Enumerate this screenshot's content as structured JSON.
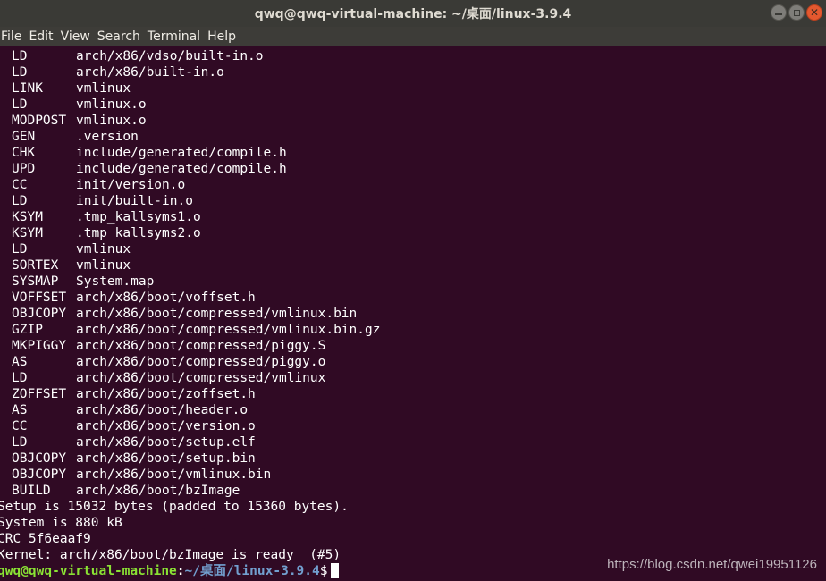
{
  "window": {
    "title": "qwq@qwq-virtual-machine: ~/桌面/linux-3.9.4",
    "buttons": {
      "minimize": "minimize",
      "maximize": "maximize",
      "close": "close"
    }
  },
  "menu": {
    "items": [
      "File",
      "Edit",
      "View",
      "Search",
      "Terminal",
      "Help"
    ]
  },
  "terminal": {
    "build_lines": [
      {
        "cmd": "LD",
        "target": "arch/x86/vdso/built-in.o"
      },
      {
        "cmd": "LD",
        "target": "arch/x86/built-in.o"
      },
      {
        "cmd": "LINK",
        "target": "vmlinux"
      },
      {
        "cmd": "LD",
        "target": "vmlinux.o"
      },
      {
        "cmd": "MODPOST",
        "target": "vmlinux.o"
      },
      {
        "cmd": "GEN",
        "target": ".version"
      },
      {
        "cmd": "CHK",
        "target": "include/generated/compile.h"
      },
      {
        "cmd": "UPD",
        "target": "include/generated/compile.h"
      },
      {
        "cmd": "CC",
        "target": "init/version.o"
      },
      {
        "cmd": "LD",
        "target": "init/built-in.o"
      },
      {
        "cmd": "KSYM",
        "target": ".tmp_kallsyms1.o"
      },
      {
        "cmd": "KSYM",
        "target": ".tmp_kallsyms2.o"
      },
      {
        "cmd": "LD",
        "target": "vmlinux"
      },
      {
        "cmd": "SORTEX",
        "target": "vmlinux"
      },
      {
        "cmd": "SYSMAP",
        "target": "System.map"
      },
      {
        "cmd": "VOFFSET",
        "target": "arch/x86/boot/voffset.h"
      },
      {
        "cmd": "OBJCOPY",
        "target": "arch/x86/boot/compressed/vmlinux.bin"
      },
      {
        "cmd": "GZIP",
        "target": "arch/x86/boot/compressed/vmlinux.bin.gz"
      },
      {
        "cmd": "MKPIGGY",
        "target": "arch/x86/boot/compressed/piggy.S"
      },
      {
        "cmd": "AS",
        "target": "arch/x86/boot/compressed/piggy.o"
      },
      {
        "cmd": "LD",
        "target": "arch/x86/boot/compressed/vmlinux"
      },
      {
        "cmd": "ZOFFSET",
        "target": "arch/x86/boot/zoffset.h"
      },
      {
        "cmd": "AS",
        "target": "arch/x86/boot/header.o"
      },
      {
        "cmd": "CC",
        "target": "arch/x86/boot/version.o"
      },
      {
        "cmd": "LD",
        "target": "arch/x86/boot/setup.elf"
      },
      {
        "cmd": "OBJCOPY",
        "target": "arch/x86/boot/setup.bin"
      },
      {
        "cmd": "OBJCOPY",
        "target": "arch/x86/boot/vmlinux.bin"
      },
      {
        "cmd": "BUILD",
        "target": "arch/x86/boot/bzImage"
      }
    ],
    "plain_lines": [
      "Setup is 15032 bytes (padded to 15360 bytes).",
      "System is 880 kB",
      "CRC 5f6eaaf9",
      "Kernel: arch/x86/boot/bzImage is ready  (#5)"
    ],
    "prompt": {
      "user_host": "qwq@qwq-virtual-machine",
      "colon": ":",
      "dir": "~/桌面/linux-3.9.4",
      "dollar": "$"
    }
  },
  "watermark": "https://blog.csdn.net/qwei19951126",
  "colors": {
    "background": "#300a24",
    "titlebar": "#3a3a36",
    "prompt_user": "#8ae234",
    "prompt_dir": "#729fcf",
    "close_button": "#e4582f"
  }
}
